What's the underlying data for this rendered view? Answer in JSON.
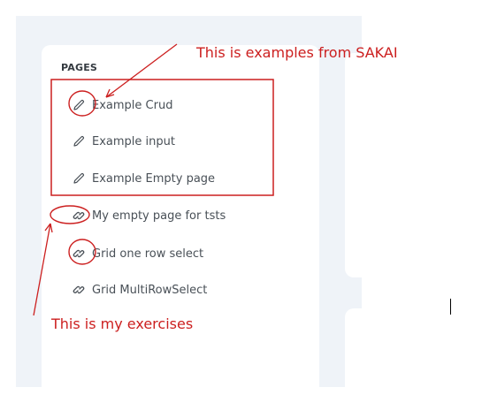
{
  "sidebar": {
    "section_title": "PAGES",
    "items": [
      {
        "label": "Example Crud",
        "icon": "pencil-icon"
      },
      {
        "label": "Example input",
        "icon": "pencil-icon"
      },
      {
        "label": "Example Empty page",
        "icon": "pencil-icon"
      },
      {
        "label": "My empty page for tsts",
        "icon": "link-icon"
      },
      {
        "label": "Grid one row select",
        "icon": "link-icon"
      },
      {
        "label": "Grid MultiRowSelect",
        "icon": "link-icon"
      }
    ]
  },
  "annotations": {
    "top_note": "This is examples from SAKAI",
    "bottom_note": "This is my exercises",
    "color": "#cc1f1f"
  }
}
